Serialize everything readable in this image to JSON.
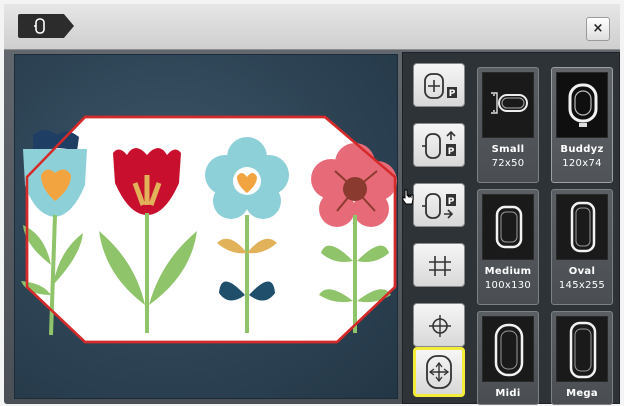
{
  "window": {
    "close_label": "×"
  },
  "hoops": [
    {
      "name": "Small",
      "size": "72x50"
    },
    {
      "name": "Buddyz",
      "size": "120x74"
    },
    {
      "name": "Medium",
      "size": "100x130"
    },
    {
      "name": "Oval",
      "size": "145x255"
    },
    {
      "name": "Midi",
      "size": ""
    },
    {
      "name": "Mega",
      "size": ""
    }
  ],
  "tools": [
    {
      "icon": "hoop-center-p-icon"
    },
    {
      "icon": "hoop-position-up-icon"
    },
    {
      "icon": "hoop-position-down-icon"
    },
    {
      "icon": "grid-icon"
    },
    {
      "icon": "crosshair-icon"
    },
    {
      "icon": "move-hoop-icon",
      "active": true
    }
  ],
  "colors": {
    "accent_selected": "#f4ec3a",
    "hoop_outline": "#d42a2a",
    "canvas_bg": "#2c4253"
  }
}
